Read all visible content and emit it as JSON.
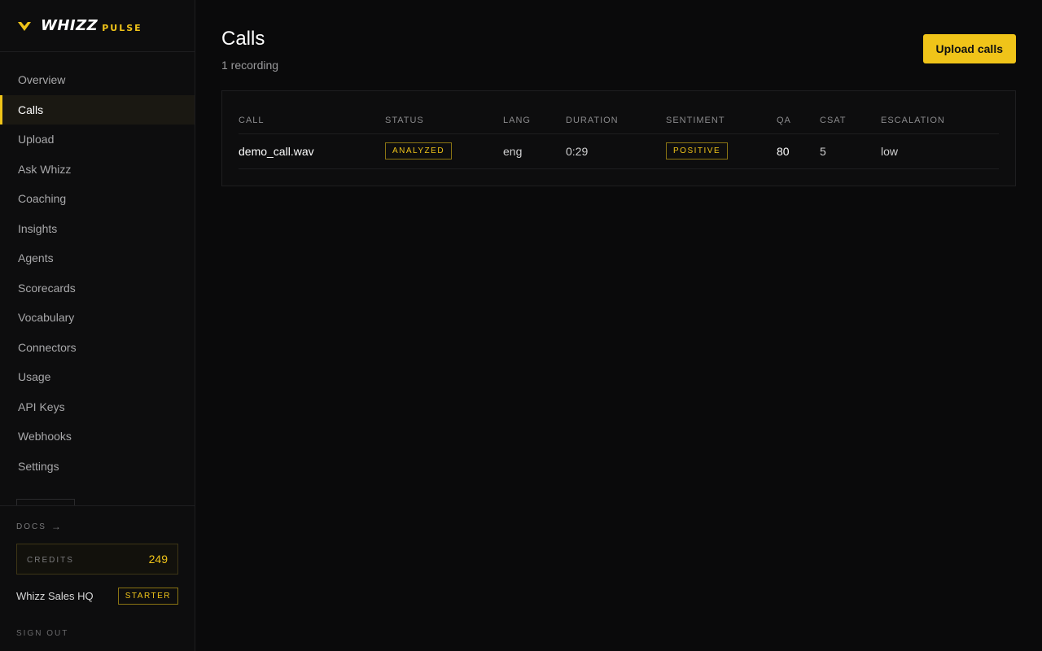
{
  "brand": {
    "name": "WHIZZ",
    "sub": "PULSE",
    "accent": "#f0c419"
  },
  "sidebar": {
    "items": [
      {
        "label": "Overview",
        "active": false
      },
      {
        "label": "Calls",
        "active": true
      },
      {
        "label": "Upload",
        "active": false
      },
      {
        "label": "Ask Whizz",
        "active": false
      },
      {
        "label": "Coaching",
        "active": false
      },
      {
        "label": "Insights",
        "active": false
      },
      {
        "label": "Agents",
        "active": false
      },
      {
        "label": "Scorecards",
        "active": false
      },
      {
        "label": "Vocabulary",
        "active": false
      },
      {
        "label": "Connectors",
        "active": false
      },
      {
        "label": "Usage",
        "active": false
      },
      {
        "label": "API Keys",
        "active": false
      },
      {
        "label": "Webhooks",
        "active": false
      },
      {
        "label": "Settings",
        "active": false
      }
    ],
    "docs_label": "DOCS",
    "docs_arrow": "→",
    "credits_label": "CREDITS",
    "credits_value": "249",
    "org_name": "Whizz Sales HQ",
    "plan": "STARTER",
    "signout_label": "SIGN OUT"
  },
  "main": {
    "title": "Calls",
    "subtitle": "1 recording",
    "upload_label": "Upload calls",
    "table": {
      "columns": [
        "CALL",
        "STATUS",
        "LANG",
        "DURATION",
        "SENTIMENT",
        "QA",
        "CSAT",
        "ESCALATION"
      ],
      "rows": [
        {
          "call": "demo_call.wav",
          "status": "ANALYZED",
          "lang": "eng",
          "duration": "0:29",
          "sentiment": "POSITIVE",
          "qa": "80",
          "csat": "5",
          "escalation": "low"
        }
      ]
    }
  }
}
